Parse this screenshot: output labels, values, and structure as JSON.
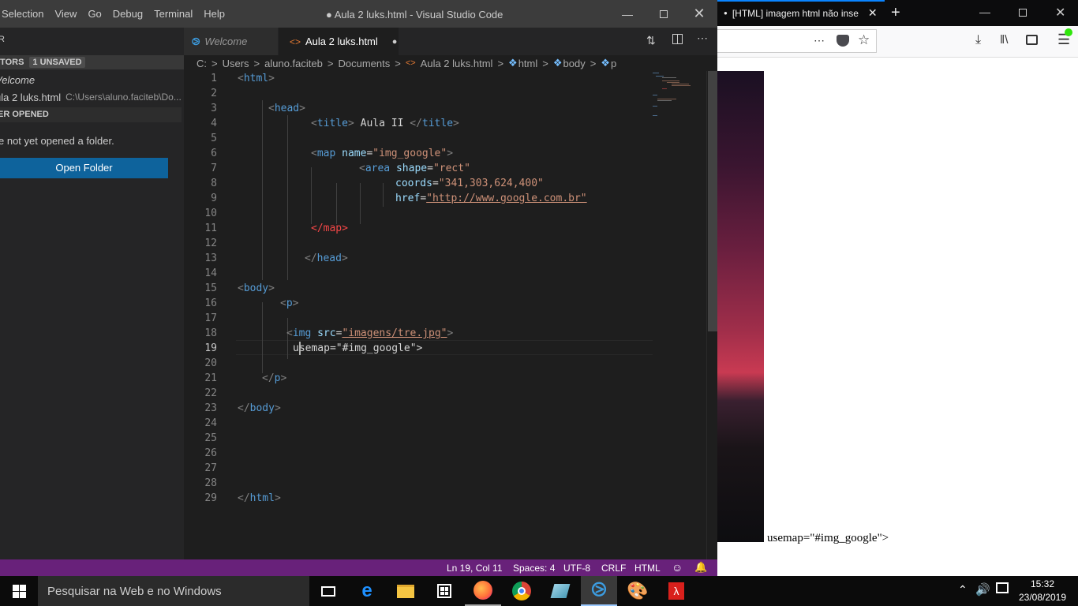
{
  "vscode": {
    "menu": [
      "Selection",
      "View",
      "Go",
      "Debug",
      "Terminal",
      "Help"
    ],
    "window_title": "● Aula 2 luks.html - Visual Studio Code",
    "sidebar": {
      "explorer_letter": "R",
      "open_editors_label": "ITORS",
      "unsaved_badge": "1 UNSAVED",
      "item_welcome": "Velcome",
      "item_file": "ula 2 luks.html",
      "item_file_path": "C:\\Users\\aluno.faciteb\\Do...",
      "folder_section": "ER OPENED",
      "no_folder_msg": "e not yet opened a folder.",
      "open_folder_button": "Open Folder"
    },
    "tabs": [
      {
        "label": "Welcome",
        "active": false
      },
      {
        "label": "Aula 2 luks.html",
        "active": true,
        "dirty_dot": "●"
      }
    ],
    "breadcrumbs": [
      "C:",
      ">",
      "Users",
      ">",
      "aluno.faciteb",
      ">",
      "Documents",
      ">",
      "Aula 2 luks.html",
      ">",
      "html",
      ">",
      "body",
      ">",
      "p"
    ],
    "line_numbers": [
      "1",
      "2",
      "3",
      "4",
      "5",
      "6",
      "7",
      "8",
      "9",
      "10",
      "11",
      "12",
      "13",
      "14",
      "15",
      "16",
      "17",
      "18",
      "19",
      "20",
      "21",
      "22",
      "23",
      "24",
      "25",
      "26",
      "27",
      "28",
      "29"
    ],
    "code": {
      "l1_tag": "html",
      "l3_tag": "head",
      "l4_title_open": "title",
      "l4_text": " Aula II ",
      "l4_title_close": "title",
      "l6_tag": "map",
      "l6_attr": "name",
      "l6_val": "\"img_google\"",
      "l7_tag": "area",
      "l7_attr": "shape",
      "l7_val": "\"rect\"",
      "l8_attr": "coords",
      "l8_val": "\"341,303,624,400\"",
      "l9_attr": "href",
      "l9_val": "\"http://www.google.com.br\"",
      "l11_tag": "map",
      "l13_tag": "head",
      "l15_tag": "body",
      "l16_tag": "p",
      "l18_tag": "img",
      "l18_attr": "src",
      "l18_val": "\"imagens/tre.jpg\"",
      "l19_text": "usemap=\"#img_google\">",
      "l21_tag": "p",
      "l23_tag": "body",
      "l29_tag": "html"
    },
    "status": {
      "position": "Ln 19, Col 11",
      "spaces": "Spaces: 4",
      "encoding": "UTF-8",
      "eol": "CRLF",
      "language": "HTML"
    }
  },
  "firefox": {
    "tab_title": "[HTML] imagem html não inse",
    "page_text": "usemap=\"#img_google\">"
  },
  "taskbar": {
    "search_placeholder": "Pesquisar na Web e no Windows",
    "time": "15:32",
    "date": "23/08/2019"
  },
  "colors": {
    "status_bar": "#68217a",
    "accent_blue": "#0e639c",
    "tag": "#569cd6",
    "attr": "#9cdcfe",
    "string": "#ce9178"
  }
}
